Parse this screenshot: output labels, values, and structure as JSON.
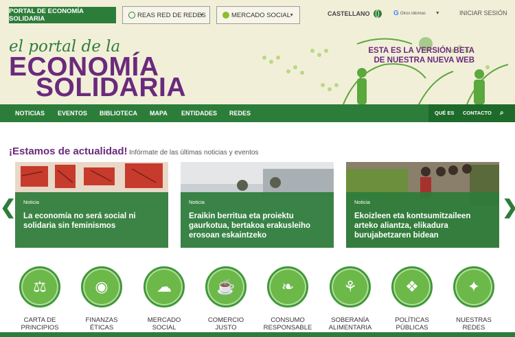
{
  "header": {
    "portal_button": "PORTAL DE ECONOMÍA SOLIDARIA",
    "dropdown_reas": "REAS RED DE REDES",
    "dropdown_mercado": "MERCADO SOCIAL",
    "language": "CASTELLANO",
    "translate_label": "Otros idiomas",
    "login": "INICIAR SESIÓN"
  },
  "hero": {
    "logo_line1": "el portal de la",
    "logo_line2": "ECONOMÍA",
    "logo_line3": "SOLIDARIA",
    "beta_line1": "ESTA ES LA VERSIÓN BETA",
    "beta_line2": "DE NUESTRA NUEVA WEB"
  },
  "nav": {
    "items": [
      "NOTICIAS",
      "EVENTOS",
      "BIBLIOTECA",
      "MAPA",
      "ENTIDADES",
      "REDES"
    ],
    "right_items": [
      "QUÉ ES",
      "CONTACTO"
    ]
  },
  "news": {
    "title": "¡Estamos de actualidad!",
    "subtitle": "Infórmate de las últimas noticias y eventos",
    "cards": [
      {
        "tag": "Noticia",
        "title": "La economía no será social ni solidaria sin feminismos"
      },
      {
        "tag": "Noticia",
        "title": "Eraikin berritua eta proiektu gaurkotua, bertakoa erakusleiho erosoan eskaintzeko"
      },
      {
        "tag": "Noticia",
        "title": "Ekoizleen eta kontsumitzaileen arteko aliantza, elikadura burujabetzaren bidean"
      }
    ]
  },
  "categories": [
    {
      "line1": "CARTA DE",
      "line2": "PRINCIPIOS",
      "icon": "scale-icon"
    },
    {
      "line1": "FINANZAS",
      "line2": "ÉTICAS",
      "icon": "piggy-bank-icon"
    },
    {
      "line1": "MERCADO",
      "line2": "SOCIAL",
      "icon": "speech-bubble-icon"
    },
    {
      "line1": "COMERCIO",
      "line2": "JUSTO",
      "icon": "coffee-cup-icon"
    },
    {
      "line1": "CONSUMO",
      "line2": "RESPONSABLE",
      "icon": "bird-icon"
    },
    {
      "line1": "SOBERANÍA",
      "line2": "ALIMENTARIA",
      "icon": "garden-tools-icon"
    },
    {
      "line1": "POLÍTICAS",
      "line2": "PÚBLICAS",
      "icon": "puzzle-icon"
    },
    {
      "line1": "NUESTRAS",
      "line2": "REDES",
      "icon": "network-icon"
    }
  ],
  "colors": {
    "green": "#2d7d3a",
    "purple": "#6a2a7c",
    "light_green": "#6cb849",
    "cream": "#f2efd9"
  }
}
